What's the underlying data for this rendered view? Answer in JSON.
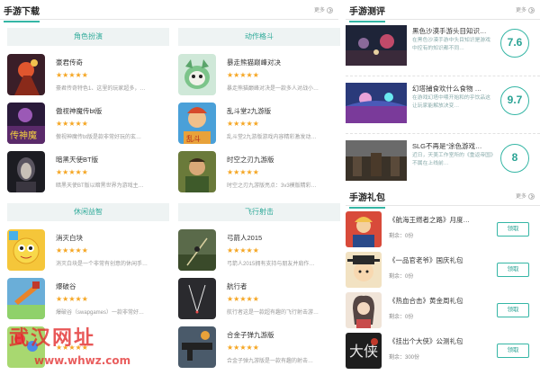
{
  "downloads": {
    "title": "手游下载",
    "more": "更多",
    "categories": [
      {
        "name": "角色扮演",
        "games": [
          {
            "name": "豪君传奇",
            "stars": "★★★★★",
            "desc": "豪君传奇特色1、这里的玩家超多，…"
          },
          {
            "name": "傲视神魔传bt版",
            "stars": "★★★★★",
            "desc": "傲视神魔传bt版是款非常好玩的玄…"
          },
          {
            "name": "暗黑天使BT版",
            "stars": "★★★★★",
            "desc": "暗黑天使BT版以暗黑世界为游戏主…"
          }
        ]
      },
      {
        "name": "动作格斗",
        "games": [
          {
            "name": "暴走熊猫巅峰对决",
            "stars": "★★★★★",
            "desc": "暴走熊猫巅峰对决是一款多人对战小…"
          },
          {
            "name": "乱斗堂2九游版",
            "stars": "★★★★★",
            "desc": "乱斗堂2九游版游戏内容精彩激发动…"
          },
          {
            "name": "时空之刃九游版",
            "stars": "★★★★★",
            "desc": "时空之刃九游版亮点：3v3模版精彩…"
          }
        ]
      },
      {
        "name": "休闲益智",
        "games": [
          {
            "name": "消灭白块",
            "stars": "★★★★★",
            "desc": "消灭白块是一个非常有创意的休闲手…"
          },
          {
            "name": "爆破谷",
            "stars": "★★★★★",
            "desc": "爆破谷（swapgames）一款非常好…"
          },
          {
            "name": "",
            "stars": "★★★★★",
            "desc": ""
          }
        ]
      },
      {
        "name": "飞行射击",
        "games": [
          {
            "name": "弓箭人2015",
            "stars": "★★★★★",
            "desc": "弓箭人2015拥有支持与朋友并肩作…"
          },
          {
            "name": "航行者",
            "stars": "★★★★★",
            "desc": "航行者这是一款超有趣的飞行射击游…"
          },
          {
            "name": "合金子弹九游版",
            "stars": "★★★★★",
            "desc": "合金子弹九游版是一款有趣的射击…"
          }
        ]
      }
    ]
  },
  "reviews": {
    "title": "手游测评",
    "more": "更多",
    "items": [
      {
        "title": "黑色沙漠手游头目知识…",
        "desc": "在黑色沙漠手游中头目知识是游戏中控有的知识都不同…",
        "score": "7.6"
      },
      {
        "title": "幻塔捕食欢什么食物 …",
        "desc": "在游戏幻塔中喂开始和的乎饮品这让玩家能解放决变…",
        "score": "9.7"
      },
      {
        "title": "SLG不再是“涂色游戏…",
        "desc": "近日，天美工作室所的《重返帝国》不属在上线前…",
        "score": "8"
      }
    ]
  },
  "gifts": {
    "title": "手游礼包",
    "more": "更多",
    "items": [
      {
        "name": "《航海王燃者之路》月度…",
        "remaining": "剩余：0份",
        "button": "领取"
      },
      {
        "name": "《一品官老爷》国庆礼包",
        "remaining": "剩余：0份",
        "button": "领取"
      },
      {
        "name": "《热血合击》黄金周礼包",
        "remaining": "剩余：0份",
        "button": "领取"
      },
      {
        "name": "《挂出个大侠》公测礼包",
        "remaining": "剩余：300份",
        "button": "领取"
      }
    ]
  },
  "watermark": {
    "line1": "武汉网址",
    "line2": "www.whwz.com"
  }
}
